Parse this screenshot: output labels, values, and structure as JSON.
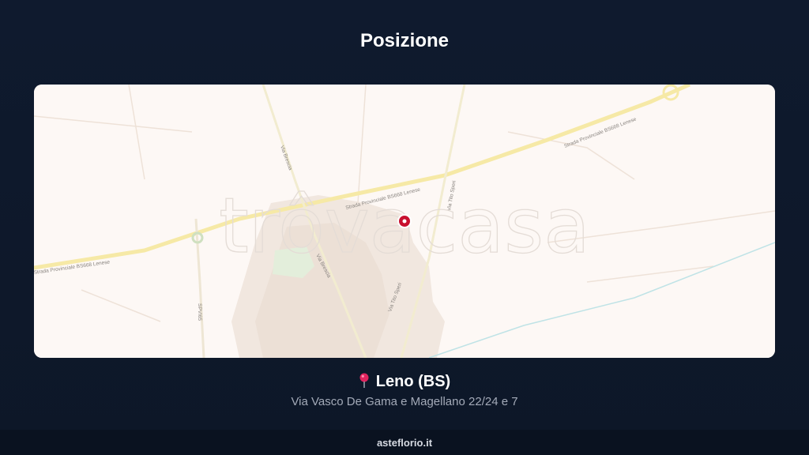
{
  "header": {
    "title": "Posizione"
  },
  "map": {
    "watermark": "trôvacasa",
    "road_labels": {
      "sp_east": "Strada Provinciale BS668 Lenese",
      "sp_center": "Strada Provinciale BS668 Lenese",
      "sp_west": "Strada Provinciale BS668 Lenese",
      "via_brescia_north": "Via Brescia",
      "via_brescia_south": "Via Brescia",
      "via_tito_speri_north": "Via Tito Speri",
      "via_tito_speri_south": "Via Tito Speri",
      "spvl65": "SPVI65"
    },
    "marker_icon": "map-marker-icon",
    "colors": {
      "background": "#fdf8f5",
      "road": "#f6e9a6",
      "marker": "#c8102e",
      "park": "#e3eedb"
    }
  },
  "location": {
    "pin_icon": "pushpin-icon",
    "city": "Leno (BS)",
    "address": "Via Vasco De Gama e Magellano 22/24 e 7"
  },
  "footer": {
    "site": "asteflorio.it"
  }
}
